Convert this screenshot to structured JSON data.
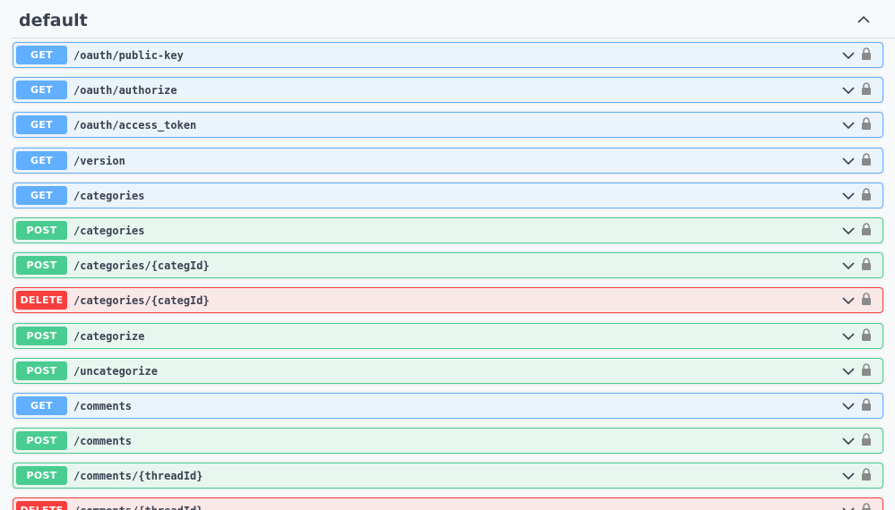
{
  "section": {
    "title": "default"
  },
  "operations": [
    {
      "method": "GET",
      "path": "/oauth/public-key"
    },
    {
      "method": "GET",
      "path": "/oauth/authorize"
    },
    {
      "method": "GET",
      "path": "/oauth/access_token"
    },
    {
      "method": "GET",
      "path": "/version"
    },
    {
      "method": "GET",
      "path": "/categories"
    },
    {
      "method": "POST",
      "path": "/categories"
    },
    {
      "method": "POST",
      "path": "/categories/{categId}"
    },
    {
      "method": "DELETE",
      "path": "/categories/{categId}"
    },
    {
      "method": "POST",
      "path": "/categorize"
    },
    {
      "method": "POST",
      "path": "/uncategorize"
    },
    {
      "method": "GET",
      "path": "/comments"
    },
    {
      "method": "POST",
      "path": "/comments"
    },
    {
      "method": "POST",
      "path": "/comments/{threadId}"
    },
    {
      "method": "DELETE",
      "path": "/comments/{threadId}"
    }
  ],
  "colors": {
    "get": "#61affe",
    "post": "#49cc90",
    "delete": "#f93e3e",
    "text": "#3b4151"
  },
  "icons": {
    "collapse": "chevron-up-icon",
    "expand": "chevron-down-icon",
    "auth": "lock-icon"
  }
}
